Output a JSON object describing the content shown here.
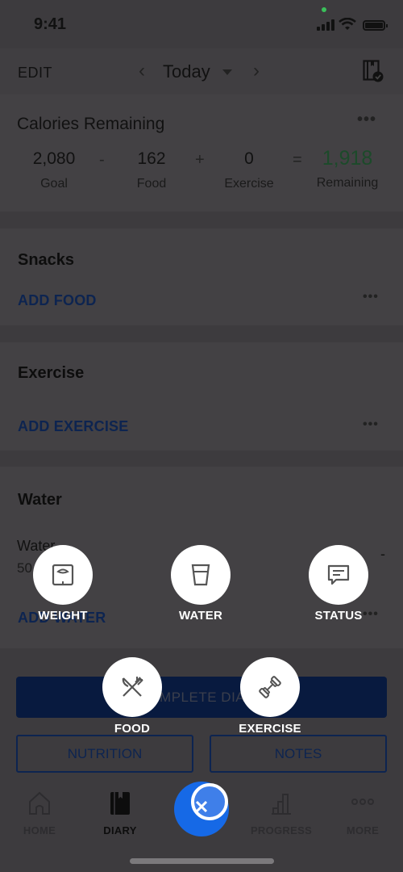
{
  "status_bar": {
    "time": "9:41"
  },
  "header": {
    "edit_label": "EDIT",
    "prev_icon": "‹",
    "next_icon": "›",
    "date_title": "Today",
    "action_icon": "diary-complete-icon"
  },
  "calories": {
    "title": "Calories Remaining",
    "more": "•••",
    "goal": {
      "value": "2,080",
      "label": "Goal"
    },
    "food": {
      "value": "162",
      "label": "Food"
    },
    "exercise": {
      "value": "0",
      "label": "Exercise"
    },
    "remaining": {
      "value": "1,918",
      "label": "Remaining"
    },
    "ops": {
      "minus": "-",
      "plus": "+",
      "equals": "="
    },
    "remaining_color": "#1c4a2a"
  },
  "sections": {
    "snacks": {
      "title": "Snacks",
      "add_label": "ADD FOOD",
      "more": "•••"
    },
    "exercise": {
      "title": "Exercise",
      "add_label": "ADD EXERCISE",
      "more": "•••"
    },
    "water": {
      "title": "Water",
      "row_label": "Water",
      "row_value": "50",
      "dash": "-",
      "add_label": "ADD WATER",
      "more": "•••"
    }
  },
  "buttons": {
    "complete_diary": "COMPLETE DIARY",
    "nutrition": "NUTRITION",
    "notes": "NOTES"
  },
  "tabbar": {
    "items": [
      {
        "label": "HOME",
        "icon": "home-icon"
      },
      {
        "label": "DIARY",
        "icon": "diary-icon",
        "active": true
      },
      {
        "label": "PROGRESS",
        "icon": "progress-icon"
      },
      {
        "label": "MORE",
        "icon": "more-icon"
      }
    ]
  },
  "quick_add": {
    "fab_color": "#1669e6",
    "items": [
      {
        "label": "WEIGHT",
        "icon": "scale-icon"
      },
      {
        "label": "WATER",
        "icon": "water-glass-icon"
      },
      {
        "label": "STATUS",
        "icon": "chat-bubble-icon"
      },
      {
        "label": "FOOD",
        "icon": "fork-knife-icon"
      },
      {
        "label": "EXERCISE",
        "icon": "dumbbell-icon"
      }
    ]
  }
}
